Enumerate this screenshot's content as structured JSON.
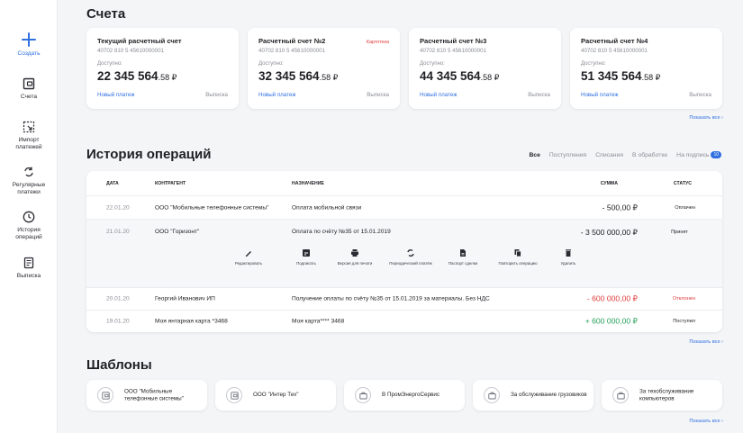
{
  "sidebar": {
    "items": [
      {
        "label": "Создать",
        "icon": "plus-icon"
      },
      {
        "label": "Счета",
        "icon": "wallet-icon"
      },
      {
        "label": "Импорт платежей",
        "icon": "import-icon"
      },
      {
        "label": "Регулярные платежи",
        "icon": "repeat-icon"
      },
      {
        "label": "История операций",
        "icon": "clock-icon"
      },
      {
        "label": "Выписка",
        "icon": "statement-icon"
      }
    ]
  },
  "accounts": {
    "title": "Счета",
    "show_all": "Показать все",
    "items": [
      {
        "title": "Текущий расчетный счет",
        "number": "40702 810 5 45610000001",
        "available_label": "Доступно:",
        "amount_int": "22 345 564",
        "amount_frac": ".58 ₽",
        "new_payment": "Новый платеж",
        "statement": "Выписка"
      },
      {
        "title": "Расчетный счет №2",
        "badge": "Картотека",
        "number": "40702 810 5 45610000001",
        "available_label": "Доступно:",
        "amount_int": "32 345 564",
        "amount_frac": ".58 ₽",
        "new_payment": "Новый платеж",
        "statement": "Выписка"
      },
      {
        "title": "Расчетный счет №3",
        "number": "40702 810 5 45610000001",
        "available_label": "Доступно:",
        "amount_int": "44 345 564",
        "amount_frac": ".58 ₽",
        "new_payment": "Новый платеж",
        "statement": "Выписка"
      },
      {
        "title": "Расчетный счет №4",
        "number": "40702 810 5 45610000001",
        "available_label": "Доступно:",
        "amount_int": "51 345 564",
        "amount_frac": ".58 ₽",
        "new_payment": "Новый платеж",
        "statement": "Выписка"
      }
    ]
  },
  "history": {
    "title": "История операций",
    "show_all": "Показать все",
    "tabs": [
      {
        "label": "Все",
        "active": true
      },
      {
        "label": "Поступления"
      },
      {
        "label": "Списания"
      },
      {
        "label": "В обработке"
      },
      {
        "label": "На подпись",
        "count": "10"
      }
    ],
    "columns": {
      "date": "ДАТА",
      "contractor": "КОНТРАГЕНТ",
      "purpose": "НАЗНАЧЕНИЕ",
      "sum": "СУММА",
      "status": "СТАТУС"
    },
    "rows": [
      {
        "date": "22.01.20",
        "contractor": "ООО \"Мобильные телефонные системы\"",
        "purpose": "Оплата мобильной связи",
        "sum": "- 500,00 ₽",
        "status": "Оплачен"
      },
      {
        "date": "21.01.20",
        "contractor": "ООО \"Горизонт\"",
        "purpose": "Оплата по счёту №35 от 15.01.2019",
        "sum": "- 3 500 000,00 ₽",
        "status": "Принят"
      },
      {
        "date": "20.01.20",
        "contractor": "Георгий Иванович ИП",
        "purpose": "Получение оплаты по счёту №35 от 15.01.2019 за материалы. Без НДС",
        "sum": "- 600 000,00 ₽",
        "status": "Отклонен"
      },
      {
        "date": "19.01.20",
        "contractor": "Моя янтарная карта *3468",
        "purpose": "Моя карта**** 3468",
        "sum": "+ 600 000,00 ₽",
        "status": "Поступил"
      }
    ],
    "actions": [
      {
        "label": "Редактировать",
        "icon": "pencil-icon"
      },
      {
        "label": "Подписать",
        "icon": "sign-icon"
      },
      {
        "label": "Версия для печати",
        "icon": "printer-icon"
      },
      {
        "label": "Периодический платёж",
        "icon": "recurring-icon"
      },
      {
        "label": "Паспорт сделки",
        "icon": "passport-icon"
      },
      {
        "label": "Повторить операцию",
        "icon": "copy-icon"
      },
      {
        "label": "Удалить",
        "icon": "trash-icon"
      }
    ]
  },
  "templates": {
    "title": "Шаблоны",
    "show_all": "Показать все",
    "items": [
      {
        "label": "ООО \"Мобильные телефонные системы\"",
        "icon": "wallet-icon"
      },
      {
        "label": "ООО \"Интер Тех\"",
        "icon": "wallet-icon"
      },
      {
        "label": "В ПромЭнергоСервис",
        "icon": "briefcase-icon"
      },
      {
        "label": "За обслуживание грузовиков",
        "icon": "briefcase-icon"
      },
      {
        "label": "За техобслуживание компьютеров",
        "icon": "briefcase-icon"
      }
    ]
  },
  "colors": {
    "accent": "#2f6fe0",
    "negative": "#e03a3a",
    "positive": "#27a05a"
  }
}
